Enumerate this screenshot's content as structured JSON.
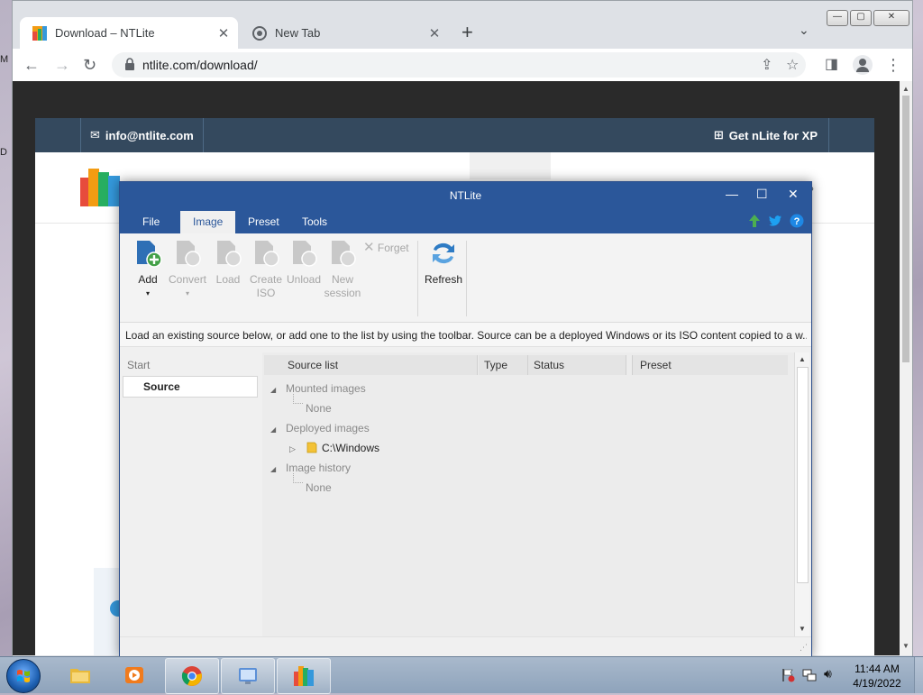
{
  "desktop": {
    "edge_texts": [
      "M",
      "D"
    ]
  },
  "browser": {
    "tabs": [
      {
        "title": "Download – NTLite",
        "active": true
      },
      {
        "title": "New Tab",
        "active": false
      }
    ],
    "url": "ntlite.com/download/"
  },
  "site": {
    "email": "info@ntlite.com",
    "xp_link": "Get nLite for XP"
  },
  "ntlite": {
    "title": "NTLite",
    "menu": [
      "File",
      "Image",
      "Preset",
      "Tools"
    ],
    "active_menu": "Image",
    "ribbon": {
      "add": "Add",
      "convert": "Convert",
      "load": "Load",
      "create_iso_1": "Create",
      "create_iso_2": "ISO",
      "unload": "Unload",
      "new_session_1": "New",
      "new_session_2": "session",
      "forget": "Forget",
      "refresh": "Refresh"
    },
    "info": "Load an existing source below, or add one to the list by using the toolbar. Source can be a deployed Windows or its ISO content copied to a w...",
    "left": {
      "start": "Start",
      "source": "Source"
    },
    "columns": {
      "source_list": "Source list",
      "type": "Type",
      "status": "Status",
      "preset": "Preset"
    },
    "tree": {
      "mounted": "Mounted images",
      "mounted_none": "None",
      "deployed": "Deployed images",
      "windows": "C:\\Windows",
      "history": "Image history",
      "history_none": "None"
    }
  },
  "taskbar": {
    "time": "11:44 AM",
    "date": "4/19/2022"
  }
}
